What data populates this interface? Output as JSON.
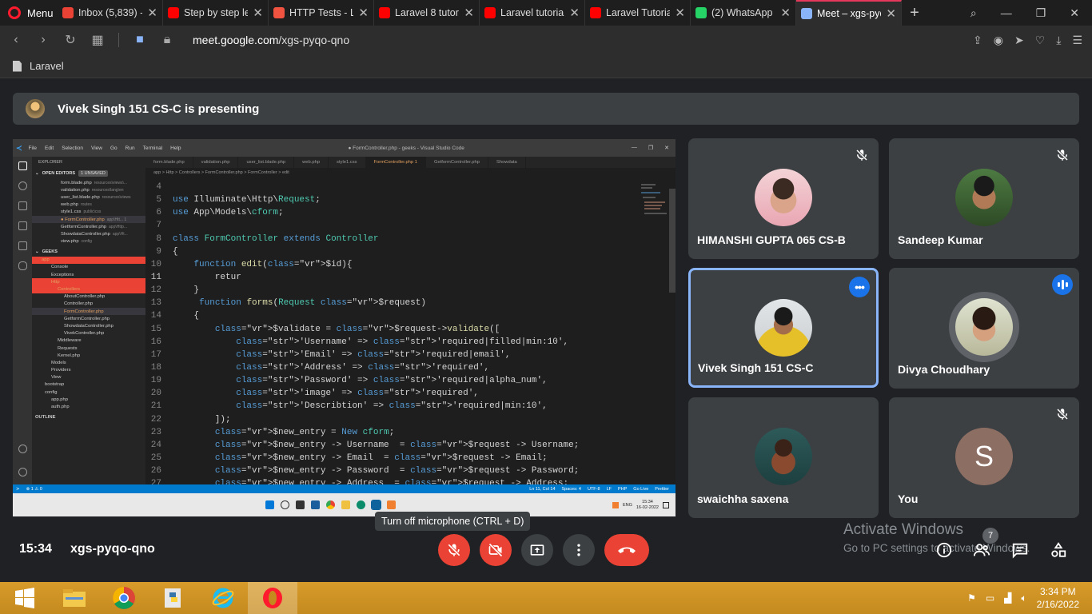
{
  "browser": {
    "menu_label": "Menu",
    "tabs": [
      {
        "label": "Inbox (5,839) -",
        "color": "#ea4335"
      },
      {
        "label": "Step by step le",
        "color": "#ff0000"
      },
      {
        "label": "HTTP Tests - La",
        "color": "#f05340"
      },
      {
        "label": "Laravel 8 tutori",
        "color": "#ff0000"
      },
      {
        "label": "Laravel tutorial",
        "color": "#ff0000"
      },
      {
        "label": "Laravel Tutorial",
        "color": "#ff0000"
      },
      {
        "label": "(2) WhatsApp",
        "color": "#25d366"
      },
      {
        "label": "Meet – xgs-pyq",
        "color": "#8ab4f8"
      }
    ],
    "url_domain": "meet.google.com",
    "url_path": "/xgs-pyqo-qno",
    "bookmark": "Laravel"
  },
  "meet": {
    "presenting_text": "Vivek Singh 151 CS-C is presenting",
    "time": "15:34",
    "code": "xgs-pyqo-qno",
    "tooltip": "Turn off microphone (CTRL + D)",
    "participants_count": "7",
    "activate_title": "Activate Windows",
    "activate_sub": "Go to PC settings to activate Windows.",
    "tiles": [
      {
        "name": "HIMANSHI GUPTA 065 CS-B"
      },
      {
        "name": "Sandeep Kumar"
      },
      {
        "name": "Vivek Singh 151 CS-C"
      },
      {
        "name": "Divya Choudhary"
      },
      {
        "name": "swaichha saxena"
      },
      {
        "name": "You",
        "initial": "S"
      }
    ]
  },
  "vscode": {
    "menu": [
      "File",
      "Edit",
      "Selection",
      "View",
      "Go",
      "Run",
      "Terminal",
      "Help"
    ],
    "window_title": "● FormController.php - geeks - Visual Studio Code",
    "explorer_title": "EXPLORER",
    "open_editors_label": "OPEN EDITORS",
    "unsaved_label": "1 UNSAVED",
    "open_editors": [
      {
        "name": "form.blade.php",
        "path": "resources\\views\\..."
      },
      {
        "name": "validation.php",
        "path": "resources\\lang\\en"
      },
      {
        "name": "user_list.blade.php",
        "path": "resources\\views"
      },
      {
        "name": "web.php",
        "path": "routes"
      },
      {
        "name": "style1.css",
        "path": "public\\css"
      },
      {
        "name": "● FormController.php",
        "path": "app\\Htt... 1"
      },
      {
        "name": "GetformController.php",
        "path": "app\\Http..."
      },
      {
        "name": "ShowdataController.php",
        "path": "app\\Ht..."
      },
      {
        "name": "view.php",
        "path": "config"
      }
    ],
    "project_label": "GEEKS",
    "tree": [
      "app",
      "Console",
      "Exceptions",
      "Http",
      "Controllers",
      "AboutController.php",
      "Controller.php",
      "FormController.php",
      "GetformController.php",
      "ShowdataController.php",
      "VivekController.php",
      "Middleware",
      "Requests",
      "Kernel.php",
      "Models",
      "Providers",
      "View",
      "bootstrap",
      "config",
      "app.php",
      "auth.php",
      "OUTLINE"
    ],
    "editor_tabs": [
      "form.blade.php",
      "validation.php",
      "user_list.blade.php",
      "web.php",
      "style1.css",
      "FormController.php 1",
      "GetformController.php",
      "Showdata"
    ],
    "breadcrumbs": "app > Http > Controllers > FormController.php > FormController > edit",
    "code_lines": [
      {
        "n": "4",
        "t": ""
      },
      {
        "n": "5",
        "t": "use Illuminate\\Http\\Request;"
      },
      {
        "n": "6",
        "t": "use App\\Models\\cform;"
      },
      {
        "n": "7",
        "t": ""
      },
      {
        "n": "8",
        "t": "class FormController extends Controller"
      },
      {
        "n": "9",
        "t": "{"
      },
      {
        "n": "10",
        "t": "    function edit($id){"
      },
      {
        "n": "11",
        "t": "        retur"
      },
      {
        "n": "12",
        "t": "    }"
      },
      {
        "n": "13",
        "t": "     function forms(Request $request)"
      },
      {
        "n": "14",
        "t": "    {"
      },
      {
        "n": "15",
        "t": "        $validate = $request->validate(["
      },
      {
        "n": "16",
        "t": "            'Username' => 'required|filled|min:10',"
      },
      {
        "n": "17",
        "t": "            'Email' => 'required|email',"
      },
      {
        "n": "18",
        "t": "            'Address' => 'required',"
      },
      {
        "n": "19",
        "t": "            'Password' => 'required|alpha_num',"
      },
      {
        "n": "20",
        "t": "            'image' => 'required',"
      },
      {
        "n": "21",
        "t": "            'Describtion' => 'required|min:10',"
      },
      {
        "n": "22",
        "t": "        ]);"
      },
      {
        "n": "23",
        "t": "        $new_entry = New cform;"
      },
      {
        "n": "24",
        "t": "        $new_entry -> Username  = $request -> Username;"
      },
      {
        "n": "25",
        "t": "        $new_entry -> Email  = $request -> Email;"
      },
      {
        "n": "26",
        "t": "        $new_entry -> Password  = $request -> Password;"
      },
      {
        "n": "27",
        "t": "        $new_entry -> Address  = $request -> Address;"
      }
    ],
    "status_left": "⊗ 1 ⚠ 0",
    "status_right": [
      "Ln 11, Col 14",
      "Spaces: 4",
      "UTF-8",
      "LF",
      "PHP",
      "Go Live",
      "Prettier"
    ],
    "inner_time": "15:34",
    "inner_date": "16-02-2022",
    "inner_lang": "ENG"
  },
  "taskbar": {
    "time": "3:34 PM",
    "date": "2/16/2022"
  }
}
